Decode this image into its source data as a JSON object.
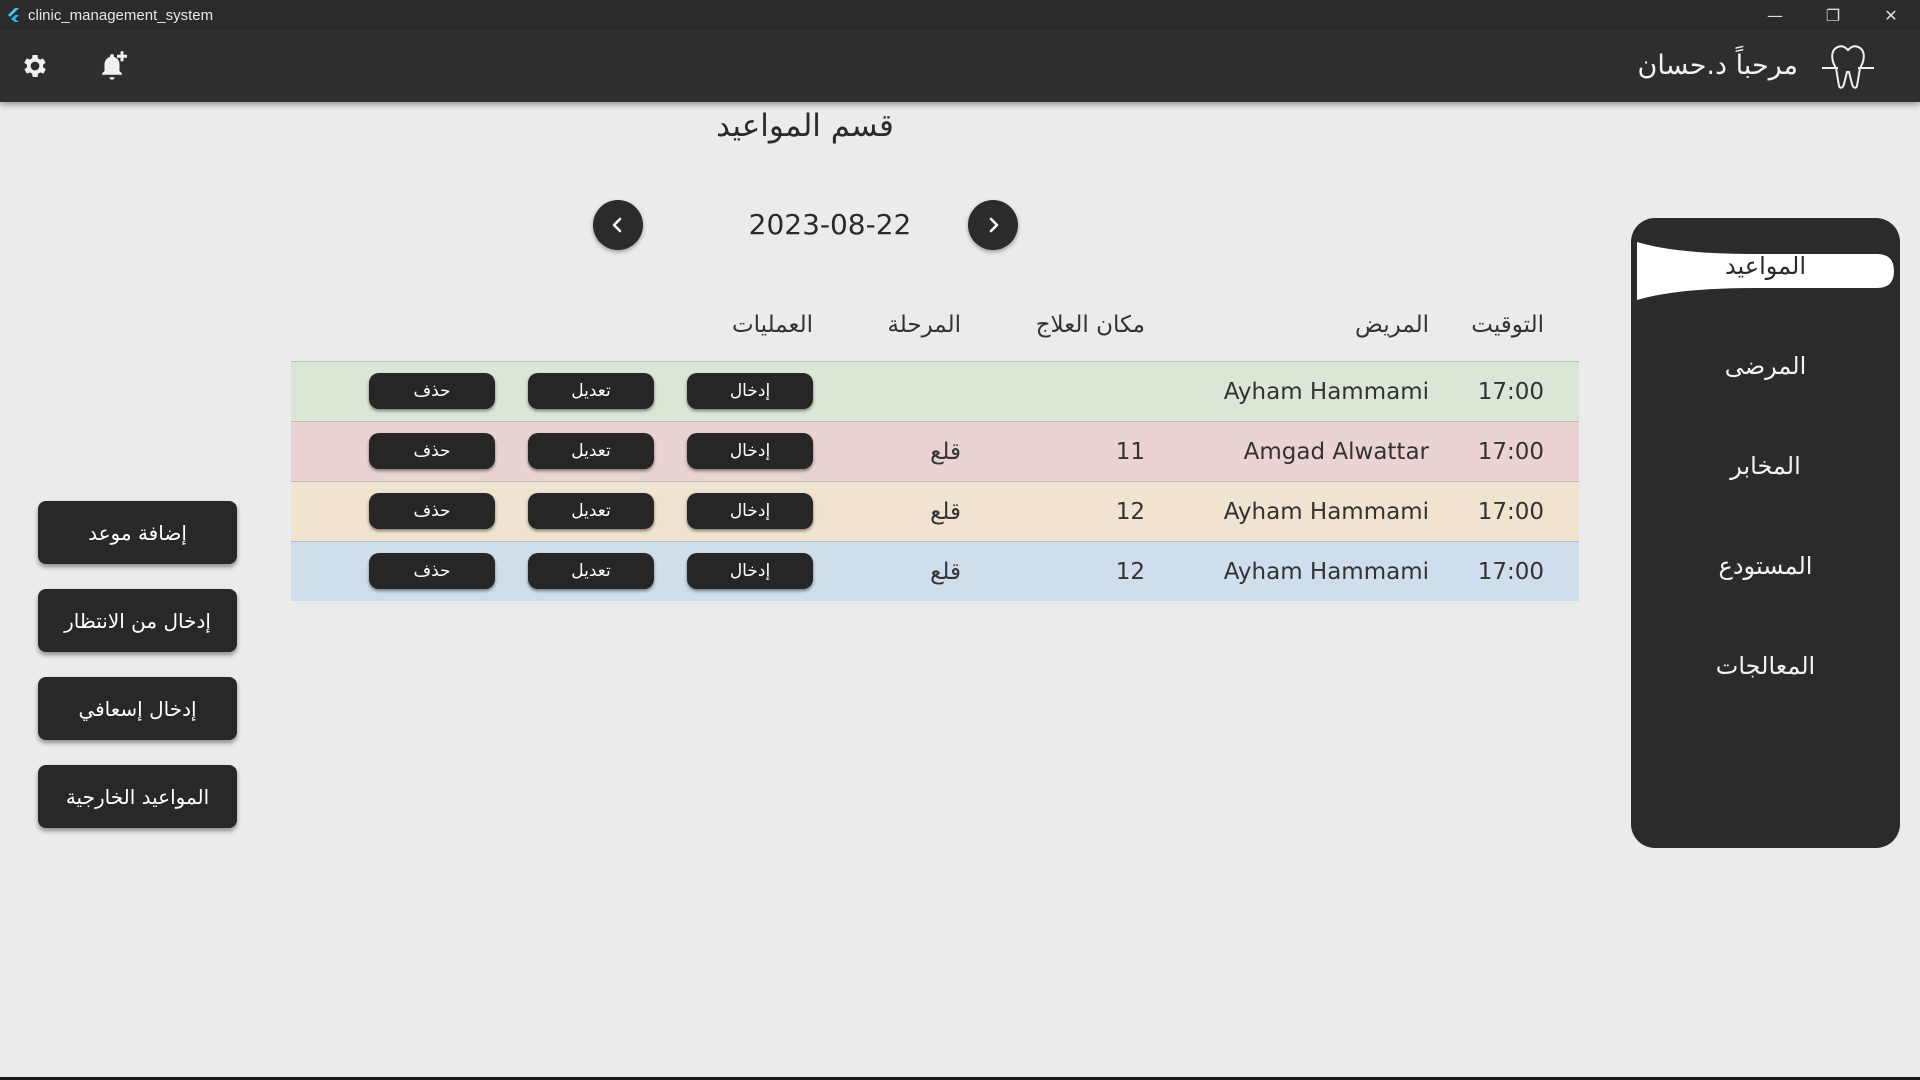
{
  "window": {
    "title": "clinic_management_system",
    "controls": [
      "—",
      "❐",
      "✕"
    ]
  },
  "appbar": {
    "greeting": "مرحباً د.حسان",
    "icons": [
      "gear-icon",
      "bell-add-icon",
      "tooth-logo"
    ]
  },
  "page": {
    "title": "قسم المواعيد",
    "date": "2023-08-22",
    "nav_icons": [
      "chevron-left-icon",
      "chevron-right-icon"
    ]
  },
  "table": {
    "headers": {
      "time": "التوقيت",
      "patient": "المريض",
      "place": "مكان العلاج",
      "stage": "المرحلة",
      "operations": "العمليات"
    },
    "rows": [
      {
        "time": "17:00",
        "patient": "Ayham Hammami",
        "place": "",
        "stage": "",
        "color": "#dbe7d6",
        "enter": "إدخال",
        "edit": "تعديل",
        "delete": "حذف"
      },
      {
        "time": "17:00",
        "patient": "Amgad Alwattar",
        "place": "11",
        "stage": "قلع",
        "color": "#ecd3d3",
        "enter": "إدخال",
        "edit": "تعديل",
        "delete": "حذف"
      },
      {
        "time": "17:00",
        "patient": "Ayham Hammami",
        "place": "12",
        "stage": "قلع",
        "color": "#f0e3cf",
        "enter": "إدخال",
        "edit": "تعديل",
        "delete": "حذف"
      },
      {
        "time": "17:00",
        "patient": "Ayham Hammami",
        "place": "12",
        "stage": "قلع",
        "color": "#cfdeec",
        "enter": "إدخال",
        "edit": "تعديل",
        "delete": "حذف"
      }
    ]
  },
  "actions": {
    "add": "إضافة موعد",
    "from_waiting": "إدخال من الانتظار",
    "emergency": "إدخال إسعافي",
    "external": "المواعيد الخارجية"
  },
  "sidebar": {
    "items": [
      {
        "label": "المواعيد",
        "active": true
      },
      {
        "label": "المرضى",
        "active": false
      },
      {
        "label": "المخابر",
        "active": false
      },
      {
        "label": "المستودع",
        "active": false
      },
      {
        "label": "المعالجات",
        "active": false
      }
    ]
  },
  "colors": {
    "dark": "#2b2b2b",
    "background": "#ebebeb"
  }
}
